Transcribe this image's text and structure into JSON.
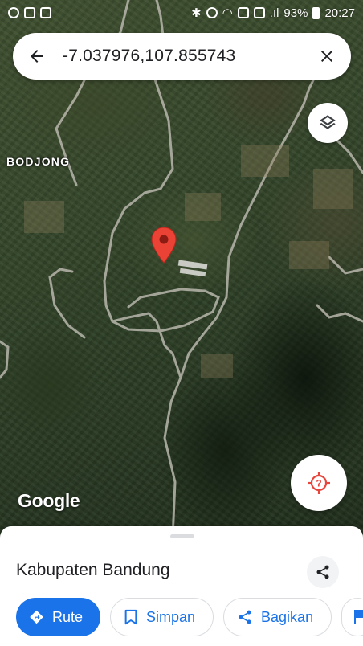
{
  "status_bar": {
    "battery": "93%",
    "time": "20:27",
    "signal": ".ıl"
  },
  "search": {
    "query": "-7.037976,107.855743"
  },
  "map": {
    "place_label": "BODJONG",
    "logo": "Google"
  },
  "place": {
    "title": "Kabupaten Bandung"
  },
  "actions": {
    "route": "Rute",
    "save": "Simpan",
    "share": "Bagikan"
  },
  "colors": {
    "accent": "#1a73e8",
    "pin": "#ea4335",
    "locate_icon": "#e8453c"
  },
  "icons": {
    "back": "arrow-left-icon",
    "close": "close-icon",
    "layers": "layers-icon",
    "pin": "map-pin-icon",
    "locate": "locate-icon",
    "share": "share-icon",
    "route": "directions-icon",
    "save": "bookmark-icon",
    "flag": "flag-icon"
  }
}
